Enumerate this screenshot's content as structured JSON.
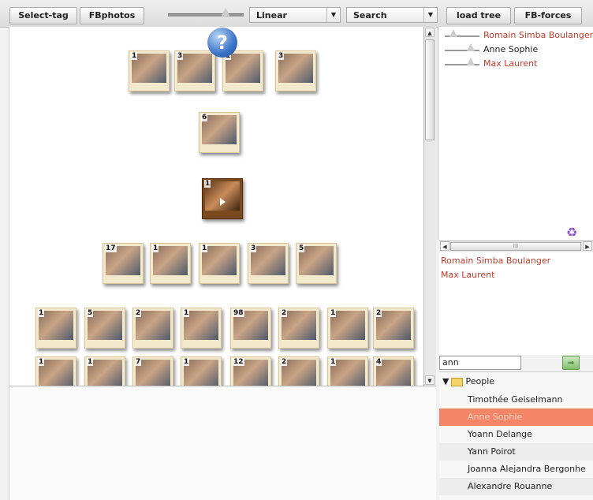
{
  "toolbar": {
    "select_tag": "Select-tag",
    "fbphotos": "FBphotos",
    "layout_value": "Linear",
    "search_label": "Search",
    "load_tree": "load tree",
    "fb_forces": "FB-forces"
  },
  "canvas": {
    "help_glyph": "?",
    "rows": [
      [
        "1",
        "3",
        "1",
        "3"
      ],
      [
        "6"
      ],
      [
        "1"
      ],
      [
        "17",
        "1",
        "1",
        "3",
        "5"
      ],
      [
        "1",
        "5",
        "2",
        "1",
        "98",
        "2",
        "1",
        "2"
      ],
      [
        "1",
        "1",
        "7",
        "1",
        "12",
        "2",
        "1",
        "4"
      ]
    ]
  },
  "tags": [
    {
      "name": "Romain Simba Boulanger",
      "color": "#c0392b",
      "level": 0.25
    },
    {
      "name": "Anne Sophie",
      "color": "#222222",
      "level": 0.75
    },
    {
      "name": "Max Laurent",
      "color": "#c0392b",
      "level": 0.75
    }
  ],
  "recycle_icon": "recycle-icon",
  "selected_people": [
    "Romain Simba Boulanger",
    "Max Laurent"
  ],
  "search": {
    "value": "ann"
  },
  "tree": {
    "folder": "People",
    "people": [
      "Timothée Geiselmann",
      "Anne Sophie",
      "Yoann Delange",
      "Yann Poirot",
      "Joanna Alejandra Bergonhe",
      "Alexandre Rouanne"
    ]
  },
  "colors": {
    "highlight": "#f48566",
    "accent_red": "#c0392b"
  }
}
